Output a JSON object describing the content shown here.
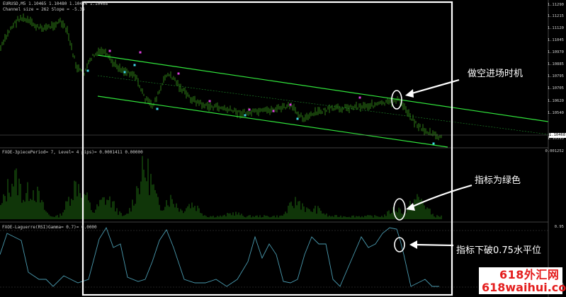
{
  "window": {
    "symbol_header": "EURUSD,M5  1.10465 1.10480 1.10434 1.10468",
    "channel_info": "Channel size = 262 Slope = -5.34"
  },
  "indicators": {
    "pane2_header": "FXOE-3piecePeriod= 7, Level= 4 pips)= 0.0001411 0.00000",
    "pane2_right_label": "0.001252",
    "pane3_header": "FXOE-Laguerre(RSI)Gamma= 0.7)= 0.0000",
    "pane3_right_top": "0.95",
    "pane3_right_bottom": "0.05"
  },
  "price_axis": {
    "ticks": [
      "1.11290",
      "1.11215",
      "1.11120",
      "1.11045",
      "1.10970",
      "1.10885",
      "1.10795",
      "1.10705",
      "1.10620",
      "1.10540",
      "1.10468",
      "1.10395"
    ],
    "current": "1.10468"
  },
  "annotations": {
    "short_entry": "做空进场时机",
    "indicator_green": "指标为绿色",
    "break_level": "指标下破0.75水平位"
  },
  "watermark": {
    "line1": "618外汇网",
    "line2": "618waihui.com"
  },
  "colors": {
    "background": "#000000",
    "candle": "#2e7d16",
    "channel": "#31e63c",
    "midline": "#1e8f2a",
    "histogram": "#1f6b12",
    "laguerre": "#4a9bb0",
    "dot_magenta": "#e040e0",
    "dot_cyan": "#40d8e8",
    "marker": "#ffffff",
    "watermark": "#e41d1d"
  }
}
